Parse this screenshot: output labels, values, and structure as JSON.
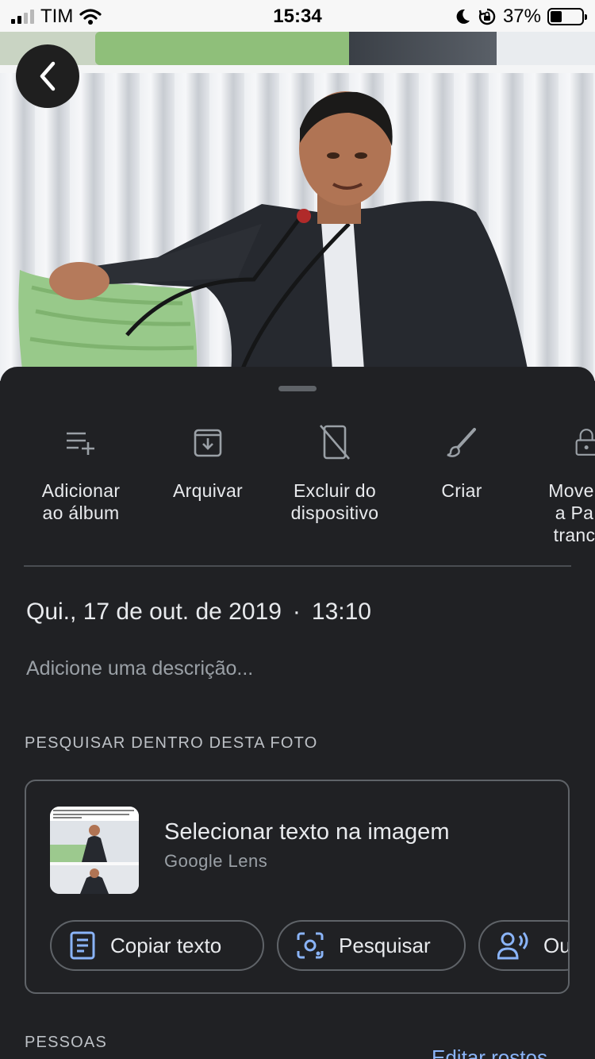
{
  "status_bar": {
    "carrier": "TIM",
    "time": "15:34",
    "battery_percent": "37%",
    "battery_level": 0.37
  },
  "back_button": {
    "icon": "chevron-left-icon"
  },
  "actions": [
    {
      "label": "Adicionar\nao álbum",
      "icon": "playlist-add-icon"
    },
    {
      "label": "Arquivar",
      "icon": "archive-icon"
    },
    {
      "label": "Excluir do\ndispositivo",
      "icon": "phone-off-icon"
    },
    {
      "label": "Criar",
      "icon": "brush-icon"
    },
    {
      "label": "Mover\na Pa\ntranc",
      "icon": "lock-icon"
    }
  ],
  "details": {
    "date": "Qui., 17 de out. de 2019",
    "separator": "·",
    "time": "13:10",
    "description_placeholder": "Adicione uma descrição..."
  },
  "search_section": {
    "heading": "PESQUISAR DENTRO DESTA FOTO",
    "card_title": "Selecionar texto na imagem",
    "card_subtitle": "Google Lens",
    "chips": [
      {
        "label": "Copiar texto",
        "icon": "document-text-icon"
      },
      {
        "label": "Pesquisar",
        "icon": "lens-search-icon"
      },
      {
        "label": "Ou",
        "icon": "record-voice-icon"
      }
    ]
  },
  "people_section": {
    "heading": "PESSOAS",
    "edit_link": "Editar rostos"
  },
  "colors": {
    "sheet_bg": "#202124",
    "accent_blue": "#8ab4f8",
    "text_primary": "#e8eaed",
    "text_secondary": "#9aa0a6"
  }
}
